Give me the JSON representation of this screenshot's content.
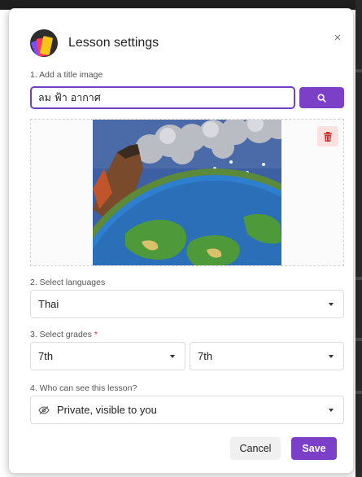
{
  "dialog": {
    "title": "Lesson settings",
    "close_icon": "close-icon",
    "close_glyph": "×"
  },
  "title_image": {
    "label": "1. Add a title image",
    "value": "ลม ฟ้า อากาศ",
    "search_icon": "search-icon",
    "delete_icon": "trash-icon",
    "image_icon": "earth-illustration"
  },
  "languages": {
    "label": "2. Select languages",
    "selected": "Thai"
  },
  "grades": {
    "label": "3. Select grades",
    "required_marker": "*",
    "from": "7th",
    "to": "7th"
  },
  "visibility": {
    "label": "4. Who can see this lesson?",
    "selected": "Private, visible to you",
    "icon": "eye-slash-icon"
  },
  "actions": {
    "cancel": "Cancel",
    "save": "Save"
  },
  "colors": {
    "accent": "#7b3fc8",
    "focus_border": "#6f42c1",
    "delete_bg": "#fde0e0",
    "delete_icon": "#d32f2f",
    "required": "#e02a2a"
  }
}
